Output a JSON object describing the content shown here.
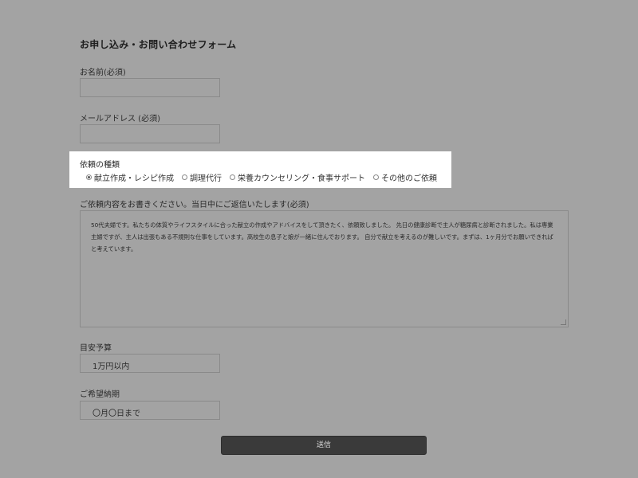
{
  "form": {
    "title": "お申し込み・お問い合わせフォーム",
    "name_label": "お名前(必須)",
    "name_value": "",
    "email_label": "メールアドレス (必須)",
    "email_value": "",
    "request_type_label": "依頼の種類",
    "request_types": [
      {
        "label": "献立作成・レシピ作成",
        "checked": true
      },
      {
        "label": "調理代行",
        "checked": false
      },
      {
        "label": "栄養カウンセリング・食事サポート",
        "checked": false
      },
      {
        "label": "その他のご依頼",
        "checked": false
      }
    ],
    "message_label": "ご依頼内容をお書きください。当日中にご返信いたします(必須)",
    "message_value": "50代夫婦です。私たちの体質やライフスタイルに合った献立の作成やアドバイスをして頂きたく、依頼致しました。 先日の健康診断で主人が糖尿病と診断されました。私は専業主婦ですが、主人は出張もある不規則な仕事をしています。高校生の息子と娘が一緒に住んでおります。 自分で献立を考えるのが難しいです。まずは、1ヶ月分でお願いできればと考えています。",
    "budget_label": "目安予算",
    "budget_value": "1万円以内",
    "deadline_label": "ご希望納期",
    "deadline_value": "〇月〇日まで",
    "submit_label": "送信"
  }
}
